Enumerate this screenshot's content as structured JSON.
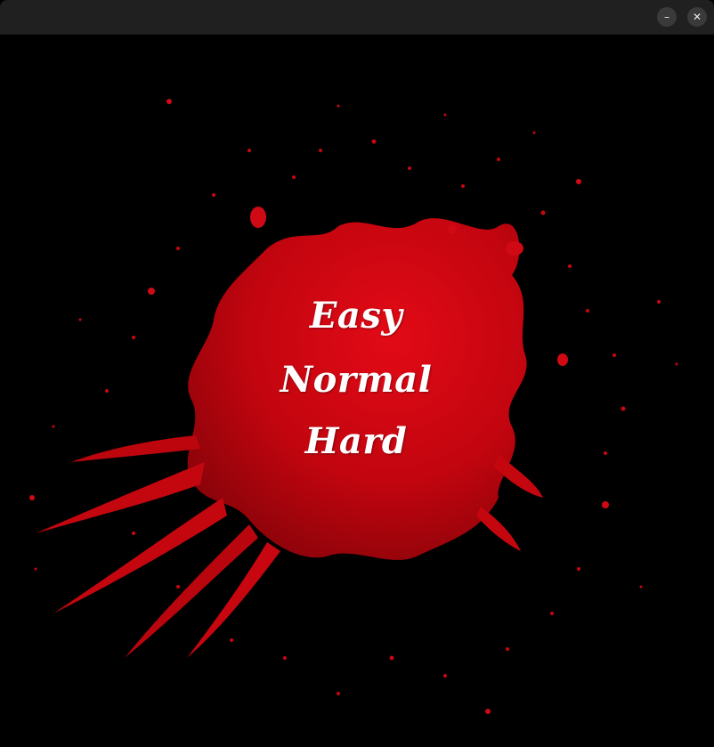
{
  "window": {
    "minimize_glyph": "–",
    "close_glyph": "✕"
  },
  "menu": {
    "items": [
      {
        "label": "Easy"
      },
      {
        "label": "Normal"
      },
      {
        "label": "Hard"
      }
    ]
  },
  "colors": {
    "background": "#000000",
    "blood": "#d00a14",
    "text": "#ffffff",
    "titlebar": "#202020"
  }
}
